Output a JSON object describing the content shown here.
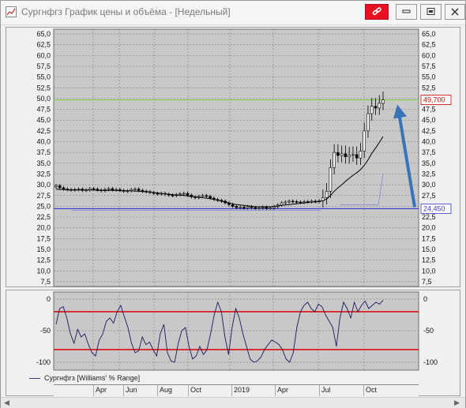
{
  "window": {
    "title": "Сургнфгз График цены и объёма - [Недельный]",
    "icon": "chart-icon",
    "link_button_icon": "link-icon",
    "link_button_color": "#e81123"
  },
  "price_panel": {
    "y_ticks": [
      "65,0",
      "62,5",
      "60,0",
      "57,5",
      "55,0",
      "52,5",
      "50,0",
      "47,5",
      "45,0",
      "42,5",
      "40,0",
      "37,5",
      "35,0",
      "32,5",
      "30,0",
      "27,5",
      "25,0",
      "22,5",
      "20,0",
      "17,5",
      "15,0",
      "12,5",
      "10,0",
      "7,5"
    ],
    "upper_level_label": "49,700",
    "lower_level_label": "24,450",
    "upper_level_color": "#7fd04a",
    "lower_level_color": "#3b3bd0",
    "arrow_color": "#3a74b8"
  },
  "indicator_panel": {
    "y_ticks": [
      "0",
      "-50",
      "-100"
    ],
    "level_line_color": "#e00000",
    "legend": "Сургнфгз [Williams' % Range]"
  },
  "date_axis": {
    "labels": [
      "Apr",
      "Jun",
      "Aug",
      "Oct",
      "2019",
      "Apr",
      "Jul",
      "Oct"
    ]
  },
  "chart_data": [
    {
      "type": "candlestick",
      "title": "",
      "ylim": [
        7.5,
        65.0
      ],
      "horizontal_levels": [
        49.7,
        24.45
      ],
      "series": [
        {
          "name": "",
          "values": [
            29.8,
            29.3,
            29.0,
            28.9,
            28.8,
            28.9,
            29.0,
            28.7,
            28.8,
            29.1,
            29.0,
            28.8,
            28.6,
            28.9,
            29.1,
            28.8,
            28.9,
            28.7,
            28.5,
            28.6,
            28.9,
            29.0,
            28.7,
            28.5,
            28.4,
            28.2,
            28.0,
            27.9,
            28.0,
            27.8,
            27.6,
            27.5,
            27.7,
            27.9,
            28.0,
            27.6,
            27.2,
            27.0,
            27.3,
            27.5,
            27.3,
            26.9,
            26.6,
            26.4,
            26.2,
            25.8,
            25.4,
            25.0,
            24.7,
            24.8,
            24.6,
            24.9,
            24.7,
            24.5,
            24.6,
            24.8,
            24.5,
            24.6,
            24.9,
            25.3,
            25.8,
            26.0,
            26.2,
            26.1,
            26.0,
            25.9,
            26.1,
            26.0,
            26.2,
            26.1,
            26.3,
            27.0,
            28.5,
            34.0,
            37.5,
            36.8,
            37.2,
            36.5,
            36.9,
            37.0,
            36.2,
            37.8,
            42.5,
            46.5,
            48.2,
            47.8,
            48.9,
            49.7
          ]
        },
        {
          "name": "",
          "values": [
            29.0,
            28.9,
            28.9,
            28.8,
            28.8,
            28.8,
            28.8,
            28.8,
            28.8,
            28.8,
            28.8,
            28.7,
            28.7,
            28.7,
            28.7,
            28.7,
            28.7,
            28.6,
            28.6,
            28.6,
            28.6,
            28.5,
            28.5,
            28.4,
            28.4,
            28.3,
            28.2,
            28.1,
            28.0,
            27.9,
            27.8,
            27.7,
            27.6,
            27.6,
            27.5,
            27.4,
            27.3,
            27.2,
            27.1,
            27.0,
            26.9,
            26.8,
            26.6,
            26.4,
            26.2,
            26.0,
            25.8,
            25.6,
            25.4,
            25.3,
            25.2,
            25.1,
            25.0,
            24.9,
            24.9,
            24.9,
            24.9,
            24.9,
            25.0,
            25.1,
            25.2,
            25.3,
            25.4,
            25.5,
            25.6,
            25.7,
            25.8,
            25.9,
            26.0,
            26.0,
            26.1,
            26.3,
            26.7,
            27.5,
            28.5,
            29.3,
            30.0,
            30.8,
            31.5,
            32.2,
            32.8,
            33.5,
            34.5,
            35.8,
            37.3,
            38.5,
            39.8,
            41.2
          ]
        }
      ]
    },
    {
      "type": "line",
      "title": "",
      "ylim": [
        -100,
        0
      ],
      "horizontal_levels": [
        -20,
        -80
      ],
      "series": [
        {
          "name": "Сургнфгз [Williams' % Range]",
          "values": [
            -40,
            -15,
            -12,
            -30,
            -55,
            -70,
            -48,
            -60,
            -55,
            -72,
            -85,
            -90,
            -65,
            -55,
            -35,
            -30,
            -38,
            -20,
            -10,
            -28,
            -45,
            -70,
            -85,
            -82,
            -60,
            -72,
            -68,
            -80,
            -90,
            -55,
            -40,
            -85,
            -98,
            -100,
            -70,
            -50,
            -45,
            -75,
            -95,
            -90,
            -75,
            -88,
            -80,
            -55,
            -25,
            -5,
            -20,
            -60,
            -88,
            -45,
            -15,
            -30,
            -55,
            -75,
            -95,
            -100,
            -98,
            -92,
            -80,
            -72,
            -65,
            -68,
            -72,
            -80,
            -95,
            -100,
            -85,
            -45,
            -20,
            -10,
            -5,
            -15,
            -20,
            -8,
            -12,
            -25,
            -35,
            -45,
            -75,
            -30,
            -5,
            -15,
            -30,
            -5,
            -20,
            -10,
            -3,
            -15,
            -10,
            -5,
            -8,
            -2
          ]
        }
      ]
    }
  ]
}
